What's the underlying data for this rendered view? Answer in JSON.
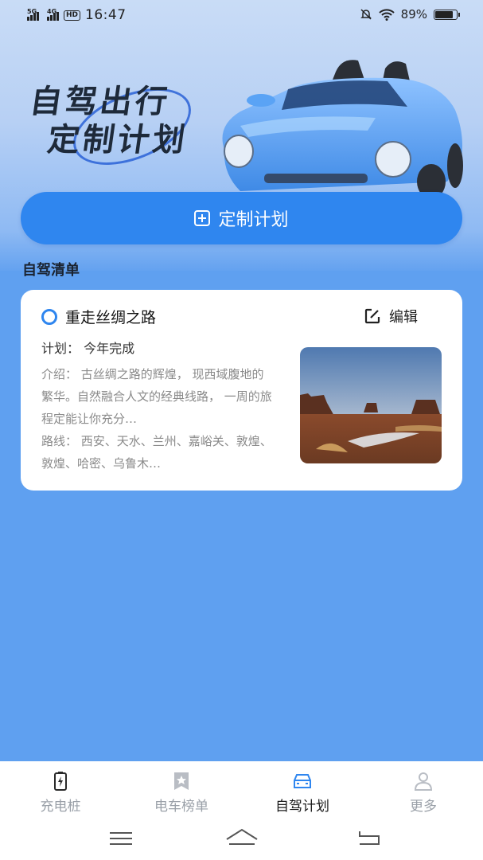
{
  "status_bar": {
    "network1": "5G",
    "network2": "4G",
    "hd": "HD",
    "time": "16:47",
    "battery": "89%",
    "battery_level": 0.89
  },
  "hero": {
    "line1": "自驾出行",
    "line2": "定制计划",
    "button_label": "定制计划"
  },
  "section": {
    "title": "自驾清单"
  },
  "card": {
    "title": "重走丝绸之路",
    "edit_label": "编辑",
    "plan_text": "计划： 今年完成",
    "intro": "介绍： 古丝绸之路的辉煌， 现西域腹地的繁华。自然融合人文的经典线路， 一周的旅程定能让你充分…",
    "route": "路线： 西安、天水、兰州、嘉峪关、敦煌、敦煌、哈密、乌鲁木…"
  },
  "tabs": [
    {
      "label": "充电桩",
      "icon": "charging-pile-icon"
    },
    {
      "label": "电车榜单",
      "icon": "ranking-star-icon"
    },
    {
      "label": "自驾计划",
      "icon": "car-icon"
    },
    {
      "label": "更多",
      "icon": "person-icon"
    }
  ],
  "colors": {
    "accent": "#2f86ef",
    "background": "#5fa0f0",
    "active_tab": "#1a1a1a",
    "inactive_tab": "#9aa0a8"
  }
}
